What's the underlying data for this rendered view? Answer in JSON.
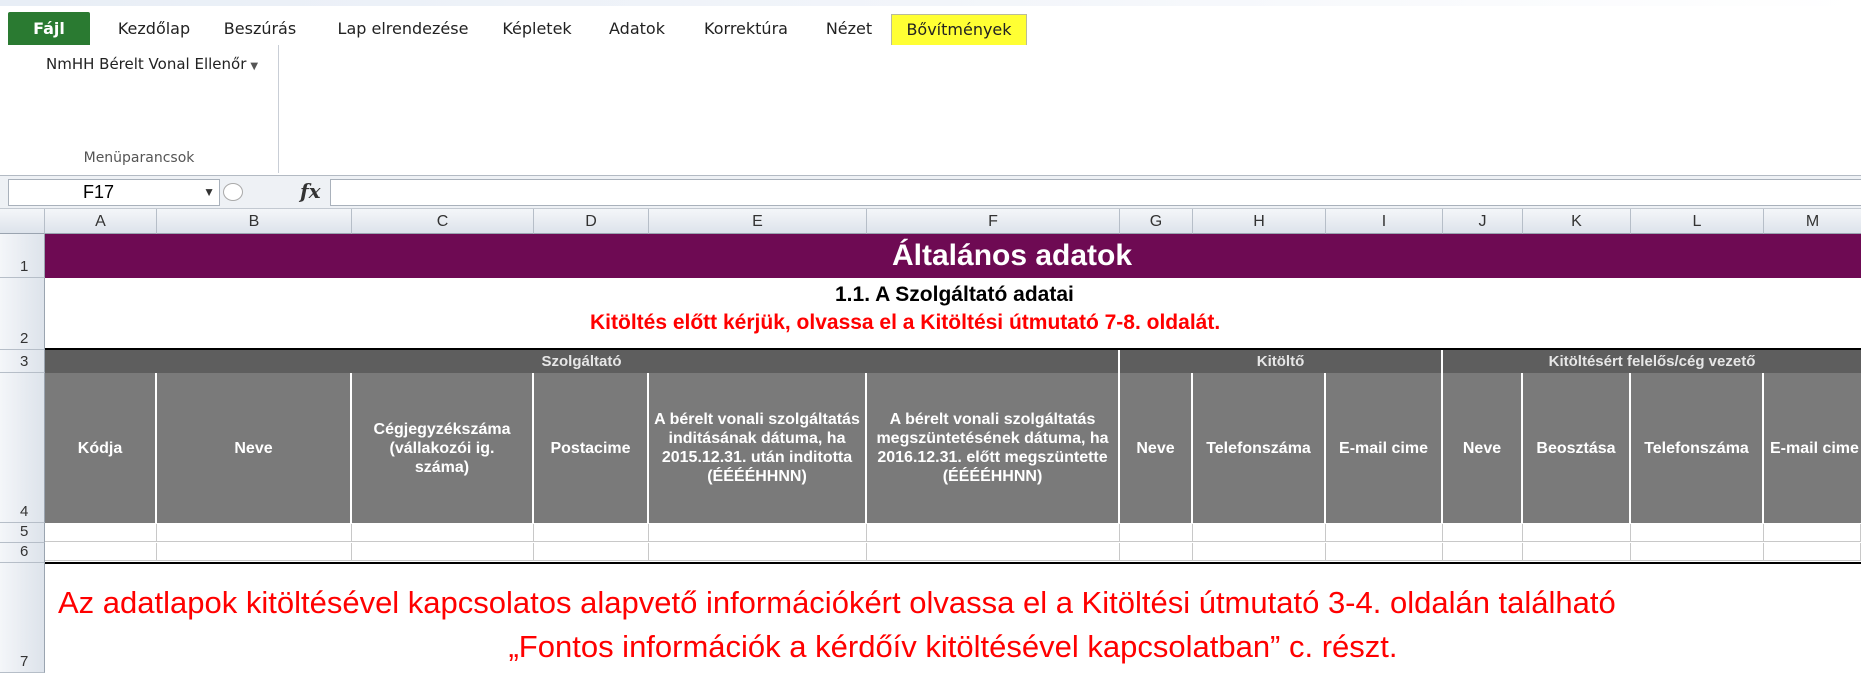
{
  "ribbon_tabs": [
    {
      "label": "Fájl"
    },
    {
      "label": "Kezdőlap"
    },
    {
      "label": "Beszúrás"
    },
    {
      "label": "Lap elrendezése"
    },
    {
      "label": "Képletek"
    },
    {
      "label": "Adatok"
    },
    {
      "label": "Korrektúra"
    },
    {
      "label": "Nézet"
    },
    {
      "label": "Bővítmények"
    }
  ],
  "ribbon": {
    "menu_command": "NmHH Bérelt Vonal Ellenőr",
    "group_label": "Menüparancsok"
  },
  "formula_bar": {
    "cell_ref": "F17",
    "fx_label": "fx",
    "formula": ""
  },
  "columns": [
    "A",
    "B",
    "C",
    "D",
    "E",
    "F",
    "G",
    "H",
    "I",
    "J",
    "K",
    "L",
    "M"
  ],
  "rows": [
    "1",
    "2",
    "3",
    "4",
    "5",
    "6",
    "7"
  ],
  "sheet": {
    "title": "Általános adatok",
    "subtitle": "1.1. A Szolgáltató adatai",
    "warning": "Kitöltés előtt kérjük, olvassa el a Kitöltési útmutató 7-8. oldalát.",
    "groups": [
      "Szolgáltató",
      "Kitöltő",
      "Kitöltésért felelős/cég vezető"
    ],
    "headers": [
      "Kódja",
      "Neve",
      "Cégjegyzékszáma (vállakozói ig. száma)",
      "Postacime",
      "A bérelt vonali szolgáltatás inditásának dátuma, ha 2015.12.31. után inditotta (ÉÉÉÉHHNN)",
      "A bérelt vonali szolgáltatás megszüntetésének dátuma, ha 2016.12.31. előtt megszüntette (ÉÉÉÉHHNN)",
      "Neve",
      "Telefonszáma",
      "E-mail cime",
      "Neve",
      "Beosztása",
      "Telefonszáma",
      "E-mail cime"
    ],
    "info_line1": "Az adatlapok kitöltésével kapcsolatos alapvető információkért olvassa el a Kitöltési útmutató 3-4. oldalán található",
    "info_line2": "„Fontos információk a kérdőív kitöltésével kapcsolatban” c. részt."
  },
  "colors": {
    "title_band": "#6e0a53",
    "group_band": "#5e5e5e",
    "header_cell": "#7a7a7a",
    "warning_text": "#ff0000",
    "file_tab": "#2a7a31",
    "active_tab_highlight": "#ffff33"
  }
}
